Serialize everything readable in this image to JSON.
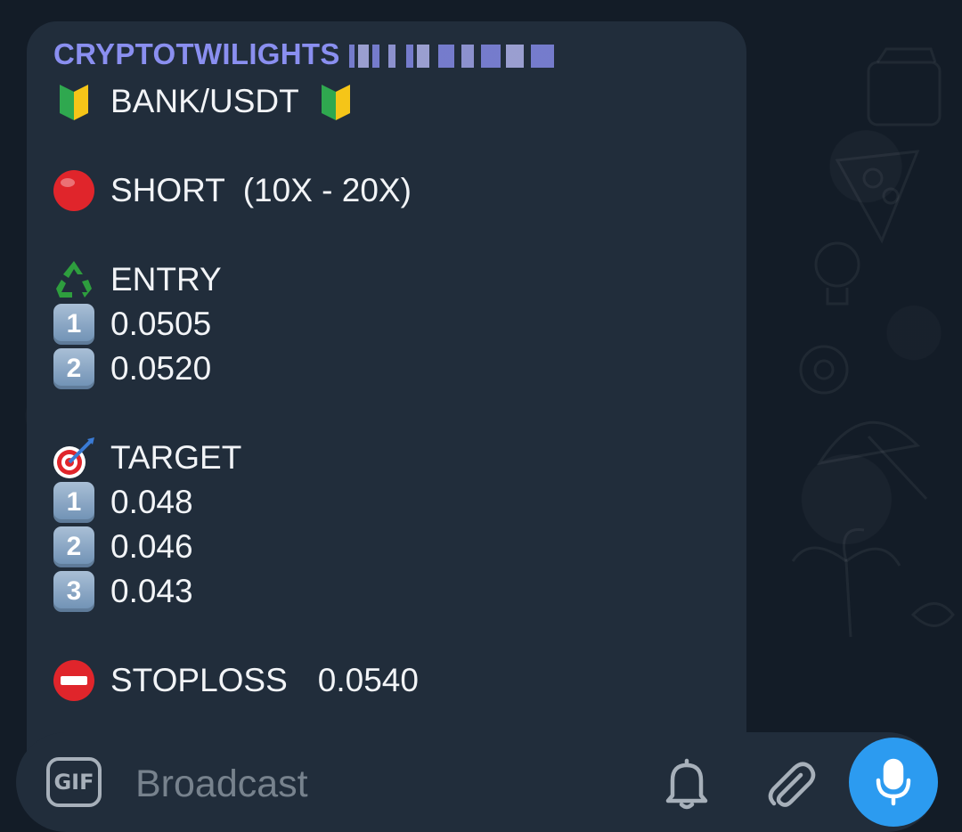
{
  "message": {
    "channel_name": "CRYPTOTWILIGHTS",
    "pair_line": "BANK/USDT",
    "direction_line": "SHORT  (10X - 20X)",
    "entry_heading": "ENTRY",
    "entries": [
      {
        "num": "1",
        "value": "0.0505"
      },
      {
        "num": "2",
        "value": "0.0520"
      }
    ],
    "target_heading": "TARGET",
    "targets": [
      {
        "num": "1",
        "value": "0.048"
      },
      {
        "num": "2",
        "value": "0.046"
      },
      {
        "num": "3",
        "value": "0.043"
      }
    ],
    "stoploss_label": "STOPLOSS",
    "stoploss_value": "0.0540"
  },
  "input_bar": {
    "gif_label": "GIF",
    "placeholder": "Broadcast"
  },
  "icons": {
    "pair": "beginner-badge-icon",
    "direction": "red-circle-icon",
    "entry": "recycle-icon",
    "target": "direct-hit-icon",
    "stoploss": "no-entry-icon",
    "notify": "bell-icon",
    "attach": "paperclip-icon",
    "send": "microphone-icon"
  },
  "colors": {
    "bubble": "#212d3b",
    "channel_name": "#8a8ff0",
    "text": "#f2f4f7",
    "mic_button": "#2c9bf0"
  }
}
